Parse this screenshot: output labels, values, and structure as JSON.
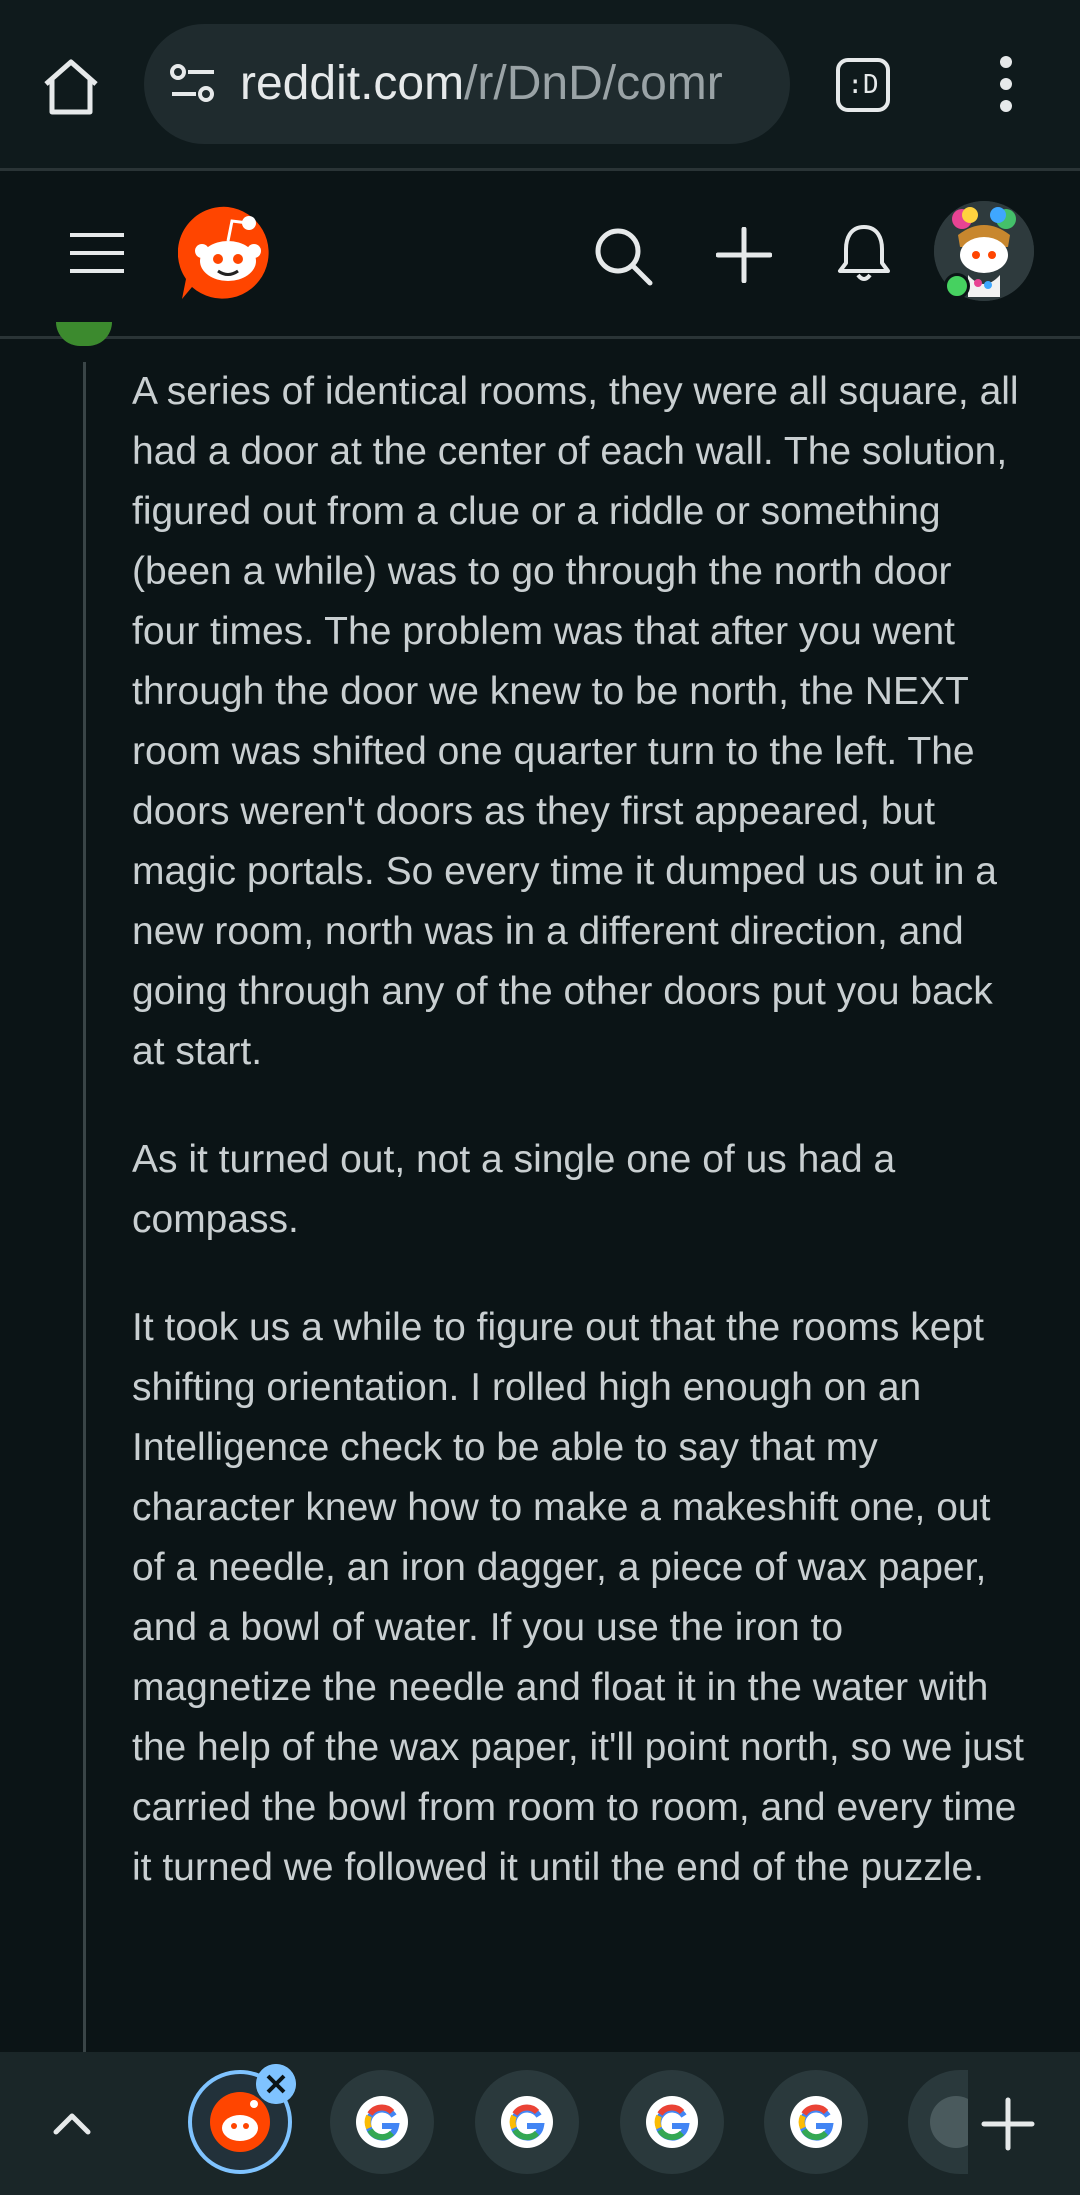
{
  "browser": {
    "url_domain": "reddit.com",
    "url_path": "/r/DnD/comr",
    "tab_switch_label": ":D"
  },
  "comment": {
    "paragraphs": [
      "A series of identical rooms, they were all square, all had a door at the center of each wall. The solution, figured out from a clue or a riddle or something (been a while) was to go through the north door four times. The problem was that after you went through the door we knew to be north, the NEXT room was shifted one quarter turn to the left. The doors weren't doors as they first appeared, but magic portals. So every time it dumped us out in a new room, north was in a different direction, and going through any of the other doors put you back at start.",
      "As it turned out, not a single one of us had a compass.",
      "It took us a while to figure out that the rooms kept shifting orientation. I rolled high enough on an Intelligence check to be able to say that my character knew how to make a makeshift one, out of a needle, an iron dagger, a piece of wax paper, and a bowl of water. If you use the iron to magnetize the needle and float it in the water with the help of the wax paper, it'll point north, so we just carried the bowl from room to room, and every time it turned we followed it until the end of the puzzle."
    ]
  },
  "colors": {
    "background": "#0b1416",
    "reddit_orange": "#ff4500",
    "active_tab_ring": "#7fc3ff",
    "online": "#46d160"
  },
  "icons": {
    "home": "home-icon",
    "site_settings": "tune-icon",
    "menu": "kebab-menu-icon",
    "hamburger": "hamburger-menu-icon",
    "search": "search-icon",
    "create": "plus-icon",
    "notifications": "bell-icon",
    "tab_strip_collapse": "chevron-up-icon",
    "tab_close": "close-icon",
    "new_tab": "plus-icon"
  }
}
